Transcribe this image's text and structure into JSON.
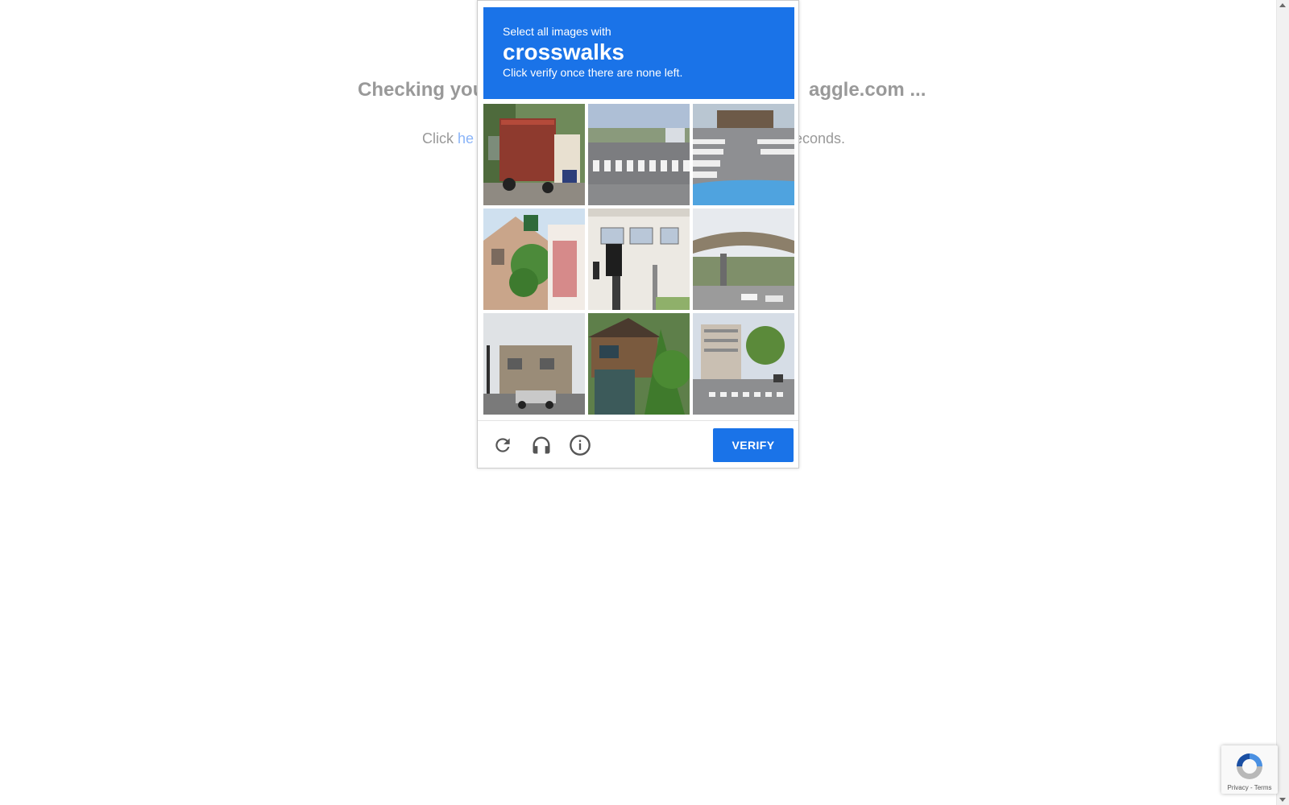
{
  "background": {
    "heading_left": "Checking you",
    "heading_right": "aggle.com ...",
    "sub_prefix": "Click ",
    "sub_link": "he",
    "sub_suffix": "econds."
  },
  "challenge": {
    "prompt_pre": "Select all images with",
    "keyword": "crosswalks",
    "prompt_post": "Click verify once there are none left.",
    "verify_label": "VERIFY",
    "accent": "#1a73e8"
  },
  "icons": {
    "reload": "reload-icon",
    "audio": "headphones-icon",
    "info": "info-icon"
  },
  "badge": {
    "privacy": "Privacy",
    "separator": " - ",
    "terms": "Terms"
  }
}
